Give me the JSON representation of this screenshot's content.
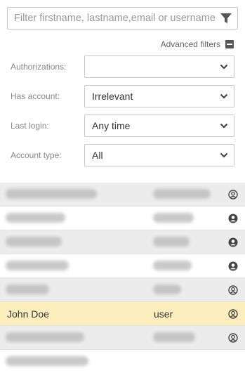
{
  "search": {
    "placeholder": "Filter firstname, lastname,email or username",
    "value": ""
  },
  "advanced_filters": {
    "label": "Advanced filters",
    "icon": "minus-square-icon"
  },
  "filters": {
    "authorizations": {
      "label": "Authorizations:",
      "value": ""
    },
    "has_account": {
      "label": "Has account:",
      "value": "Irrelevant"
    },
    "last_login": {
      "label": "Last login:",
      "value": "Any time"
    },
    "account_type": {
      "label": "Account type:",
      "value": "All"
    }
  },
  "users": [
    {
      "name": "",
      "username": "",
      "icon": "user-circle-outline-icon",
      "redacted": true,
      "row_style": "alt"
    },
    {
      "name": "",
      "username": "",
      "icon": "user-circle-solid-icon",
      "redacted": true,
      "row_style": "plain"
    },
    {
      "name": "",
      "username": "",
      "icon": "user-circle-solid-icon",
      "redacted": true,
      "row_style": "alt"
    },
    {
      "name": "",
      "username": "",
      "icon": "user-circle-solid-icon",
      "redacted": true,
      "row_style": "plain"
    },
    {
      "name": "",
      "username": "",
      "icon": "user-circle-outline-icon",
      "redacted": true,
      "row_style": "alt"
    },
    {
      "name": "John Doe",
      "username": "user",
      "icon": "user-circle-outline-icon",
      "redacted": false,
      "row_style": "selected"
    },
    {
      "name": "",
      "username": "",
      "icon": "user-circle-outline-icon",
      "redacted": true,
      "row_style": "alt"
    },
    {
      "name": "",
      "username": "",
      "icon": "",
      "redacted": true,
      "row_style": "plain"
    }
  ],
  "colors": {
    "selected_row": "#fcefbd",
    "alt_row": "#ececec",
    "icon": "#444444"
  }
}
